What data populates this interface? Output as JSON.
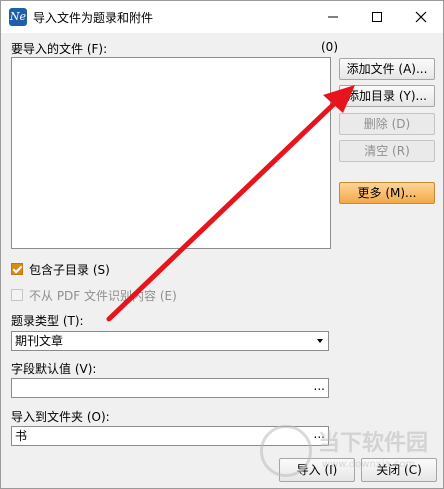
{
  "window": {
    "title": "导入文件为题录和附件",
    "icon_text": "Ne"
  },
  "files": {
    "label": "要导入的文件 (F):",
    "count": "(0)"
  },
  "buttons": {
    "add_file": "添加文件 (A)...",
    "add_dir": "添加目录 (Y)...",
    "delete": "删除 (D)",
    "clear": "清空 (R)",
    "more": "更多 (M)..."
  },
  "options": {
    "include_subdirs": "包含子目录 (S)",
    "no_pdf_recognition": "不从 PDF 文件识别内容 (E)"
  },
  "ref_type": {
    "label": "题录类型 (T):",
    "value": "期刊文章"
  },
  "field_default": {
    "label": "字段默认值 (V):",
    "value": "",
    "browse": "..."
  },
  "import_folder": {
    "label": "导入到文件夹 (O):",
    "value": "书",
    "browse": "..."
  },
  "footer": {
    "import": "导入 (I)",
    "close": "关闭 (C)"
  },
  "watermark": {
    "text": "当下软件园",
    "url": "www.downxia.com"
  },
  "colors": {
    "arrow": "#e8141b",
    "accent": "#f2a948"
  }
}
